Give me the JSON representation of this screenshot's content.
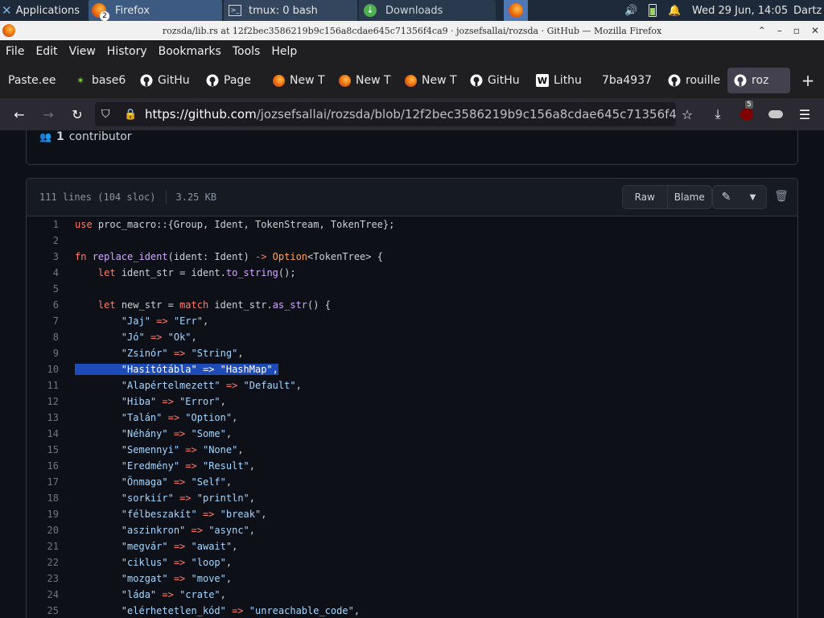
{
  "panel": {
    "apps_label": "Applications",
    "tasks": [
      {
        "label": "Firefox",
        "badge": "2"
      },
      {
        "label": "tmux: 0 bash"
      },
      {
        "label": "Downloads"
      }
    ],
    "clock": "Wed 29 Jun, 14:05",
    "user": "Dartz"
  },
  "window": {
    "title": "rozsda/lib.rs at 12f2bec3586219b9c156a8cdae645c71356f4ca9 · jozsefsallai/rozsda · GitHub — Mozilla Firefox"
  },
  "menu": [
    "File",
    "Edit",
    "View",
    "History",
    "Bookmarks",
    "Tools",
    "Help"
  ],
  "tabs": [
    {
      "label": "Paste.ee",
      "icon": "paste-icon"
    },
    {
      "label": "base6",
      "icon": "star-icon"
    },
    {
      "label": "GitHu",
      "icon": "github-icon"
    },
    {
      "label": "Page",
      "icon": "github-icon"
    },
    {
      "label": "New T",
      "icon": "firefox-icon"
    },
    {
      "label": "New T",
      "icon": "firefox-icon"
    },
    {
      "label": "New T",
      "icon": "firefox-icon"
    },
    {
      "label": "GitHu",
      "icon": "github-icon"
    },
    {
      "label": "Lithu",
      "icon": "wikipedia-icon"
    },
    {
      "label": "7ba4937",
      "icon": "blank-icon"
    },
    {
      "label": "rouille",
      "icon": "github-icon"
    },
    {
      "label": "roz",
      "icon": "github-icon"
    }
  ],
  "nav": {
    "url_host": "https://github.com",
    "url_path": "/jozsefsallai/rozsda/blob/12f2bec3586219b9c156a8cdae645c71356f4ca9/r",
    "ublock_count": "5"
  },
  "file": {
    "contributors_count": "1",
    "contributors_label": "contributor",
    "lines_info": "111 lines (104 sloc)",
    "size": "3.25 KB",
    "raw_label": "Raw",
    "blame_label": "Blame"
  },
  "code": [
    {
      "n": "1",
      "t": "use proc_macro::{Group, Ident, TokenStream, TokenTree};"
    },
    {
      "n": "2",
      "t": ""
    },
    {
      "n": "3",
      "t": "fn replace_ident(ident: Ident) -> Option<TokenTree> {"
    },
    {
      "n": "4",
      "t": "    let ident_str = ident.to_string();"
    },
    {
      "n": "5",
      "t": ""
    },
    {
      "n": "6",
      "t": "    let new_str = match ident_str.as_str() {"
    },
    {
      "n": "7",
      "t": "        \"Jaj\" => \"Err\","
    },
    {
      "n": "8",
      "t": "        \"Jó\" => \"Ok\","
    },
    {
      "n": "9",
      "t": "        \"Zsinór\" => \"String\","
    },
    {
      "n": "10",
      "t": "        \"Hasítótábla\" => \"HashMap\",",
      "selected": true
    },
    {
      "n": "11",
      "t": "        \"Alapértelmezett\" => \"Default\","
    },
    {
      "n": "12",
      "t": "        \"Hiba\" => \"Error\","
    },
    {
      "n": "13",
      "t": "        \"Talán\" => \"Option\","
    },
    {
      "n": "14",
      "t": "        \"Néhány\" => \"Some\","
    },
    {
      "n": "15",
      "t": "        \"Semennyi\" => \"None\","
    },
    {
      "n": "16",
      "t": "        \"Eredmény\" => \"Result\","
    },
    {
      "n": "17",
      "t": "        \"Önmaga\" => \"Self\","
    },
    {
      "n": "18",
      "t": "        \"sorkiír\" => \"println\","
    },
    {
      "n": "19",
      "t": "        \"félbeszakít\" => \"break\","
    },
    {
      "n": "20",
      "t": "        \"aszinkron\" => \"async\","
    },
    {
      "n": "21",
      "t": "        \"megvár\" => \"await\","
    },
    {
      "n": "22",
      "t": "        \"ciklus\" => \"loop\","
    },
    {
      "n": "23",
      "t": "        \"mozgat\" => \"move\","
    },
    {
      "n": "24",
      "t": "        \"láda\" => \"crate\","
    },
    {
      "n": "25",
      "t": "        \"elérhetetlen_kód\" => \"unreachable_code\","
    }
  ]
}
